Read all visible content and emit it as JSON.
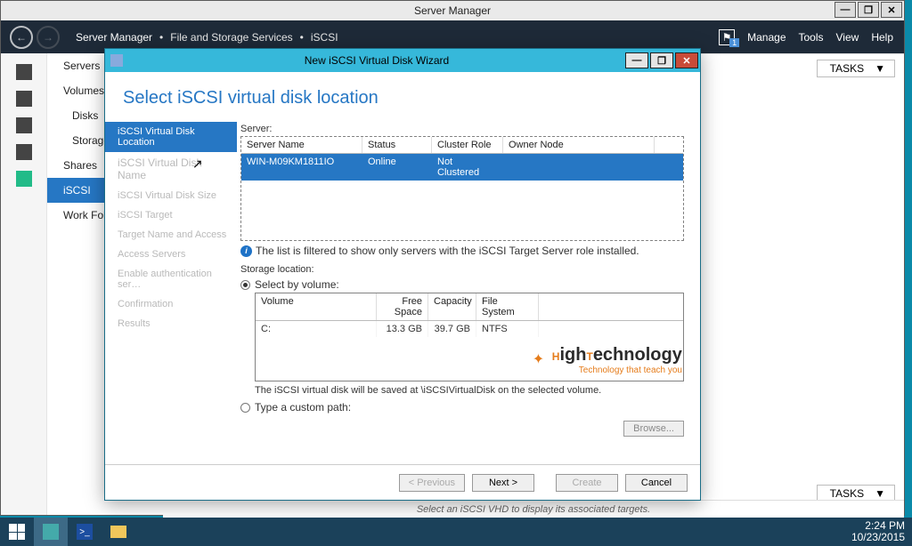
{
  "sm": {
    "title": "Server Manager",
    "breadcrumb": {
      "a": "Server Manager",
      "b": "File and Storage Services",
      "c": "iSCSI"
    },
    "menu": {
      "manage": "Manage",
      "tools": "Tools",
      "view": "View",
      "help": "Help"
    },
    "flag_badge": "1",
    "sidebar": {
      "servers": "Servers",
      "volumes": "Volumes",
      "disks": "Disks",
      "storage": "Storage",
      "shares": "Shares",
      "iscsi": "iSCSI",
      "work": "Work Fold"
    },
    "tasks": "TASKS",
    "hint": "Select an iSCSI VHD to display its associated targets."
  },
  "win": {
    "min": "—",
    "max": "❐",
    "close": "✕"
  },
  "wiz": {
    "title": "New iSCSI Virtual Disk Wizard",
    "heading": "Select iSCSI virtual disk location",
    "steps": {
      "s1": "iSCSI Virtual Disk Location",
      "s2": "iSCSI Virtual Disk Name",
      "s3": "iSCSI Virtual Disk Size",
      "s4": "iSCSI Target",
      "s5": "Target Name and Access",
      "s6": "Access Servers",
      "s7": "Enable authentication ser…",
      "s8": "Confirmation",
      "s9": "Results"
    },
    "server_label": "Server:",
    "server_cols": {
      "name": "Server Name",
      "status": "Status",
      "role": "Cluster Role",
      "owner": "Owner Node"
    },
    "server_row": {
      "name": "WIN-M09KM1811IO",
      "status": "Online",
      "role": "Not Clustered",
      "owner": ""
    },
    "filter_note": "The list is filtered to show only servers with the iSCSI Target Server role installed.",
    "storage_label": "Storage location:",
    "radio_volume": "Select by volume:",
    "vol_cols": {
      "v": "Volume",
      "f": "Free Space",
      "c": "Capacity",
      "fs": "File System"
    },
    "vol_row": {
      "v": "C:",
      "f": "13.3 GB",
      "c": "39.7 GB",
      "fs": "NTFS"
    },
    "save_note": "The iSCSI virtual disk will be saved at \\iSCSIVirtualDisk on the selected volume.",
    "radio_custom": "Type a custom path:",
    "browse": "Browse...",
    "btn": {
      "prev": "< Previous",
      "next": "Next >",
      "create": "Create",
      "cancel": "Cancel"
    }
  },
  "watermark": {
    "brand": "HighTechnology",
    "tag": "Technology that teach you"
  },
  "taskbar": {
    "time": "2:24 PM",
    "date": "10/23/2015"
  }
}
